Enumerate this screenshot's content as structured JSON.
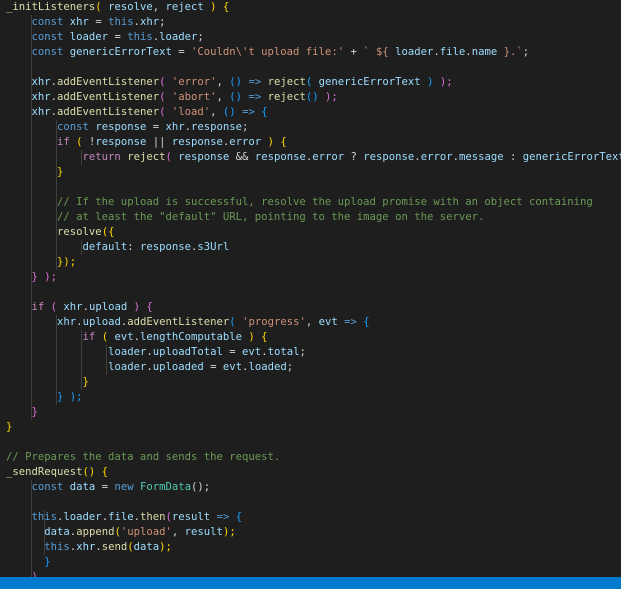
{
  "colors": {
    "default": "#d4d4d4",
    "keyword": "#569cd6",
    "control": "#c586c0",
    "function": "#dcdcaa",
    "variable": "#9cdcfe",
    "string": "#ce9178",
    "comment": "#6a9955",
    "number": "#b5cea8",
    "bracket_gold": "#ffd700",
    "bracket_purple": "#da70d6",
    "bracket_blue": "#179fff",
    "type": "#4ec9b0",
    "statusbar": "#007acc"
  },
  "code_lines": [
    [
      [
        "_initListeners",
        "function"
      ],
      [
        "( ",
        "bracket_gold"
      ],
      [
        "resolve",
        "variable"
      ],
      [
        ", ",
        "default"
      ],
      [
        "reject",
        "variable"
      ],
      [
        " ) {",
        "bracket_gold"
      ]
    ],
    [
      [
        "    ",
        "default"
      ],
      [
        "const",
        "keyword"
      ],
      [
        " ",
        "default"
      ],
      [
        "xhr",
        "variable"
      ],
      [
        " = ",
        "default"
      ],
      [
        "this",
        "keyword"
      ],
      [
        ".",
        "default"
      ],
      [
        "xhr",
        "variable"
      ],
      [
        ";",
        "default"
      ]
    ],
    [
      [
        "    ",
        "default"
      ],
      [
        "const",
        "keyword"
      ],
      [
        " ",
        "default"
      ],
      [
        "loader",
        "variable"
      ],
      [
        " = ",
        "default"
      ],
      [
        "this",
        "keyword"
      ],
      [
        ".",
        "default"
      ],
      [
        "loader",
        "variable"
      ],
      [
        ";",
        "default"
      ]
    ],
    [
      [
        "    ",
        "default"
      ],
      [
        "const",
        "keyword"
      ],
      [
        " ",
        "default"
      ],
      [
        "genericErrorText",
        "variable"
      ],
      [
        " = ",
        "default"
      ],
      [
        "'Couldn\\'t upload file:'",
        "string"
      ],
      [
        " + ",
        "default"
      ],
      [
        "` ${ ",
        "string"
      ],
      [
        "loader",
        "variable"
      ],
      [
        ".",
        "default"
      ],
      [
        "file",
        "variable"
      ],
      [
        ".",
        "default"
      ],
      [
        "name",
        "variable"
      ],
      [
        " }.`",
        "string"
      ],
      [
        ";",
        "default"
      ]
    ],
    [
      [
        "",
        "default"
      ]
    ],
    [
      [
        "    ",
        "default"
      ],
      [
        "xhr",
        "variable"
      ],
      [
        ".",
        "default"
      ],
      [
        "addEventListener",
        "function"
      ],
      [
        "( ",
        "bracket_purple"
      ],
      [
        "'error'",
        "string"
      ],
      [
        ", ",
        "default"
      ],
      [
        "()",
        "bracket_blue"
      ],
      [
        " => ",
        "keyword"
      ],
      [
        "reject",
        "function"
      ],
      [
        "( ",
        "bracket_blue"
      ],
      [
        "genericErrorText",
        "variable"
      ],
      [
        " )",
        "bracket_blue"
      ],
      [
        " );",
        "bracket_purple"
      ]
    ],
    [
      [
        "    ",
        "default"
      ],
      [
        "xhr",
        "variable"
      ],
      [
        ".",
        "default"
      ],
      [
        "addEventListener",
        "function"
      ],
      [
        "( ",
        "bracket_purple"
      ],
      [
        "'abort'",
        "string"
      ],
      [
        ", ",
        "default"
      ],
      [
        "()",
        "bracket_blue"
      ],
      [
        " => ",
        "keyword"
      ],
      [
        "reject",
        "function"
      ],
      [
        "()",
        "bracket_blue"
      ],
      [
        " );",
        "bracket_purple"
      ]
    ],
    [
      [
        "    ",
        "default"
      ],
      [
        "xhr",
        "variable"
      ],
      [
        ".",
        "default"
      ],
      [
        "addEventListener",
        "function"
      ],
      [
        "( ",
        "bracket_purple"
      ],
      [
        "'load'",
        "string"
      ],
      [
        ", ",
        "default"
      ],
      [
        "()",
        "bracket_blue"
      ],
      [
        " => ",
        "keyword"
      ],
      [
        "{",
        "bracket_blue"
      ]
    ],
    [
      [
        "        ",
        "default"
      ],
      [
        "const",
        "keyword"
      ],
      [
        " ",
        "default"
      ],
      [
        "response",
        "variable"
      ],
      [
        " = ",
        "default"
      ],
      [
        "xhr",
        "variable"
      ],
      [
        ".",
        "default"
      ],
      [
        "response",
        "variable"
      ],
      [
        ";",
        "default"
      ]
    ],
    [
      [
        "        ",
        "default"
      ],
      [
        "if",
        "control"
      ],
      [
        " ( ",
        "bracket_gold"
      ],
      [
        "!",
        "default"
      ],
      [
        "response",
        "variable"
      ],
      [
        " || ",
        "default"
      ],
      [
        "response",
        "variable"
      ],
      [
        ".",
        "default"
      ],
      [
        "error",
        "variable"
      ],
      [
        " ) {",
        "bracket_gold"
      ]
    ],
    [
      [
        "            ",
        "default"
      ],
      [
        "return",
        "control"
      ],
      [
        " ",
        "default"
      ],
      [
        "reject",
        "function"
      ],
      [
        "( ",
        "bracket_purple"
      ],
      [
        "response",
        "variable"
      ],
      [
        " && ",
        "default"
      ],
      [
        "response",
        "variable"
      ],
      [
        ".",
        "default"
      ],
      [
        "error",
        "variable"
      ],
      [
        " ? ",
        "default"
      ],
      [
        "response",
        "variable"
      ],
      [
        ".",
        "default"
      ],
      [
        "error",
        "variable"
      ],
      [
        ".",
        "default"
      ],
      [
        "message",
        "variable"
      ],
      [
        " : ",
        "default"
      ],
      [
        "genericErrorText",
        "variable"
      ],
      [
        " );",
        "bracket_purple"
      ]
    ],
    [
      [
        "        ",
        "default"
      ],
      [
        "}",
        "bracket_gold"
      ]
    ],
    [
      [
        "",
        "default"
      ]
    ],
    [
      [
        "        ",
        "default"
      ],
      [
        "// If the upload is successful, resolve the upload promise with an object containing",
        "comment"
      ]
    ],
    [
      [
        "        ",
        "default"
      ],
      [
        "// at least the \"default\" URL, pointing to the image on the server.",
        "comment"
      ]
    ],
    [
      [
        "        ",
        "default"
      ],
      [
        "resolve",
        "function"
      ],
      [
        "({",
        "bracket_gold"
      ]
    ],
    [
      [
        "            ",
        "default"
      ],
      [
        "default",
        "variable"
      ],
      [
        ": ",
        "default"
      ],
      [
        "response",
        "variable"
      ],
      [
        ".",
        "default"
      ],
      [
        "s3Url",
        "variable"
      ]
    ],
    [
      [
        "        ",
        "default"
      ],
      [
        "});",
        "bracket_gold"
      ]
    ],
    [
      [
        "    ",
        "default"
      ],
      [
        "} );",
        "bracket_purple"
      ]
    ],
    [
      [
        "",
        "default"
      ]
    ],
    [
      [
        "    ",
        "default"
      ],
      [
        "if",
        "control"
      ],
      [
        " ( ",
        "bracket_purple"
      ],
      [
        "xhr",
        "variable"
      ],
      [
        ".",
        "default"
      ],
      [
        "upload",
        "variable"
      ],
      [
        " ) {",
        "bracket_purple"
      ]
    ],
    [
      [
        "        ",
        "default"
      ],
      [
        "xhr",
        "variable"
      ],
      [
        ".",
        "default"
      ],
      [
        "upload",
        "variable"
      ],
      [
        ".",
        "default"
      ],
      [
        "addEventListener",
        "function"
      ],
      [
        "( ",
        "bracket_blue"
      ],
      [
        "'progress'",
        "string"
      ],
      [
        ", ",
        "default"
      ],
      [
        "evt",
        "variable"
      ],
      [
        " => ",
        "keyword"
      ],
      [
        "{",
        "bracket_blue"
      ]
    ],
    [
      [
        "            ",
        "default"
      ],
      [
        "if",
        "control"
      ],
      [
        " ( ",
        "bracket_gold"
      ],
      [
        "evt",
        "variable"
      ],
      [
        ".",
        "default"
      ],
      [
        "lengthComputable",
        "variable"
      ],
      [
        " ) {",
        "bracket_gold"
      ]
    ],
    [
      [
        "                ",
        "default"
      ],
      [
        "loader",
        "variable"
      ],
      [
        ".",
        "default"
      ],
      [
        "uploadTotal",
        "variable"
      ],
      [
        " = ",
        "default"
      ],
      [
        "evt",
        "variable"
      ],
      [
        ".",
        "default"
      ],
      [
        "total",
        "variable"
      ],
      [
        ";",
        "default"
      ]
    ],
    [
      [
        "                ",
        "default"
      ],
      [
        "loader",
        "variable"
      ],
      [
        ".",
        "default"
      ],
      [
        "uploaded",
        "variable"
      ],
      [
        " = ",
        "default"
      ],
      [
        "evt",
        "variable"
      ],
      [
        ".",
        "default"
      ],
      [
        "loaded",
        "variable"
      ],
      [
        ";",
        "default"
      ]
    ],
    [
      [
        "            ",
        "default"
      ],
      [
        "}",
        "bracket_gold"
      ]
    ],
    [
      [
        "        ",
        "default"
      ],
      [
        "} );",
        "bracket_blue"
      ]
    ],
    [
      [
        "    ",
        "default"
      ],
      [
        "}",
        "bracket_purple"
      ]
    ],
    [
      [
        "}",
        "bracket_gold"
      ]
    ],
    [
      [
        "",
        "default"
      ]
    ],
    [
      [
        "// Prepares the data and sends the request.",
        "comment"
      ]
    ],
    [
      [
        "_sendRequest",
        "function"
      ],
      [
        "() {",
        "bracket_gold"
      ]
    ],
    [
      [
        "    ",
        "default"
      ],
      [
        "const",
        "keyword"
      ],
      [
        " ",
        "default"
      ],
      [
        "data",
        "variable"
      ],
      [
        " = ",
        "default"
      ],
      [
        "new",
        "keyword"
      ],
      [
        " ",
        "default"
      ],
      [
        "FormData",
        "type"
      ],
      [
        "();",
        "default"
      ]
    ],
    [
      [
        "",
        "default"
      ]
    ],
    [
      [
        "    ",
        "default"
      ],
      [
        "this",
        "keyword"
      ],
      [
        ".",
        "default"
      ],
      [
        "loader",
        "variable"
      ],
      [
        ".",
        "default"
      ],
      [
        "file",
        "variable"
      ],
      [
        ".",
        "default"
      ],
      [
        "then",
        "function"
      ],
      [
        "(",
        "bracket_purple"
      ],
      [
        "result",
        "variable"
      ],
      [
        " => ",
        "keyword"
      ],
      [
        "{",
        "bracket_blue"
      ]
    ],
    [
      [
        "      ",
        "default"
      ],
      [
        "data",
        "variable"
      ],
      [
        ".",
        "default"
      ],
      [
        "append",
        "function"
      ],
      [
        "(",
        "bracket_gold"
      ],
      [
        "'upload'",
        "string"
      ],
      [
        ", ",
        "default"
      ],
      [
        "result",
        "variable"
      ],
      [
        ");",
        "bracket_gold"
      ]
    ],
    [
      [
        "      ",
        "default"
      ],
      [
        "this",
        "keyword"
      ],
      [
        ".",
        "default"
      ],
      [
        "xhr",
        "variable"
      ],
      [
        ".",
        "default"
      ],
      [
        "send",
        "function"
      ],
      [
        "(",
        "bracket_gold"
      ],
      [
        "data",
        "variable"
      ],
      [
        ");",
        "bracket_gold"
      ]
    ],
    [
      [
        "      ",
        "default"
      ],
      [
        "}",
        "bracket_blue"
      ]
    ],
    [
      [
        "    ",
        "default"
      ],
      [
        ")",
        "bracket_purple"
      ]
    ]
  ]
}
